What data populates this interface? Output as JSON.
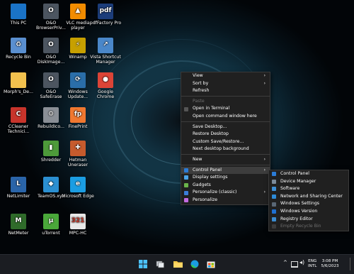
{
  "desktop": {
    "icons": [
      {
        "label": "This PC",
        "icon": "monitor-icon"
      },
      {
        "label": "O&O BrowserPriv...",
        "icon": "oo-browserprivacy-icon"
      },
      {
        "label": "VLC media player",
        "icon": "vlc-cone-icon"
      },
      {
        "label": "pdfFactory Pro",
        "icon": "pdf-icon",
        "glyph": "pdf"
      },
      {
        "label": "Recycle Bin",
        "icon": "recycle-bin-icon"
      },
      {
        "label": "O&O DiskImage...",
        "icon": "oo-diskimage-icon"
      },
      {
        "label": "Winamp",
        "icon": "winamp-icon"
      },
      {
        "label": "Vista Shortcut Manager",
        "icon": "vista-shortcut-icon"
      },
      {
        "label": "Morph's_De...",
        "icon": "folder-icon"
      },
      {
        "label": "O&O SafeErase",
        "icon": "oo-safeerase-icon"
      },
      {
        "label": "Windows Update...",
        "icon": "windows-update-icon"
      },
      {
        "label": "Google Chrome",
        "icon": "chrome-icon"
      },
      {
        "label": "CCleaner Technici...",
        "icon": "ccleaner-icon"
      },
      {
        "label": "RebuildIco...",
        "icon": "rebuildicon-icon"
      },
      {
        "label": "FinePrint",
        "icon": "fineprint-icon",
        "glyph": "fp"
      },
      {
        "label": "Shredder",
        "icon": "shredder-icon"
      },
      {
        "label": "Hetman Uneraser",
        "icon": "hetman-uneraser-icon"
      },
      {
        "label": "NetLimiter",
        "icon": "netlimiter-icon"
      },
      {
        "label": "TeamOS.xyz",
        "icon": "teamos-icon"
      },
      {
        "label": "Microsoft Edge",
        "icon": "edge-icon"
      },
      {
        "label": "NetMeter",
        "icon": "netmeter-icon"
      },
      {
        "label": "uTorrent",
        "icon": "utorrent-icon"
      },
      {
        "label": "MPC-HC",
        "icon": "mpc-hc-icon",
        "glyph": "321"
      }
    ]
  },
  "context_menu": {
    "items": [
      {
        "label": "View",
        "submenu": true
      },
      {
        "label": "Sort by",
        "submenu": true
      },
      {
        "label": "Refresh"
      },
      {
        "sep": true
      },
      {
        "label": "Paste",
        "disabled": true
      },
      {
        "label": "Open in Terminal",
        "icon": "terminal-icon"
      },
      {
        "label": "Open command window here"
      },
      {
        "sep": true
      },
      {
        "label": "Save Desktop..."
      },
      {
        "label": "Restore Desktop"
      },
      {
        "label": "Custom Save/Restore..."
      },
      {
        "label": "Next desktop background"
      },
      {
        "sep": true
      },
      {
        "label": "New",
        "submenu": true
      },
      {
        "sep": true
      },
      {
        "label": "Control Panel",
        "submenu": true,
        "highlighted": true,
        "icon": "control-panel-icon"
      },
      {
        "label": "Display settings",
        "icon": "display-icon"
      },
      {
        "label": "Gadgets",
        "icon": "gadgets-icon"
      },
      {
        "label": "Personalize (classic)",
        "submenu": true,
        "icon": "personalize-classic-icon"
      },
      {
        "label": "Personalize",
        "icon": "paintbrush-icon"
      }
    ]
  },
  "submenu": {
    "items": [
      {
        "label": "Control Panel",
        "icon": "control-panel-icon"
      },
      {
        "label": "Device Manager",
        "icon": "device-manager-icon"
      },
      {
        "label": "Software",
        "icon": "software-icon"
      },
      {
        "label": "Network and Sharing Center",
        "icon": "network-icon"
      },
      {
        "label": "Windows Settings",
        "icon": "gear-icon"
      },
      {
        "label": "Windows Version",
        "icon": "info-icon"
      },
      {
        "label": "Registry Editor",
        "icon": "registry-icon"
      },
      {
        "label": "Empty Recycle Bin",
        "icon": "recycle-bin-icon",
        "disabled": true
      }
    ]
  },
  "taskbar": {
    "apps": [
      "start-icon",
      "search-icon",
      "task-view-icon",
      "file-explorer-icon",
      "edge-icon",
      "store-icon"
    ],
    "tray": {
      "chevron": "^",
      "lang": "ENG",
      "layout": "INTL",
      "time": "3:08 PM",
      "date": "5/6/2023"
    }
  },
  "colors": {
    "accent": "#0f6cbd",
    "menu_bg": "#202020",
    "menu_hover": "#3d3d3d",
    "taskbar_bg": "#1b1d22"
  }
}
